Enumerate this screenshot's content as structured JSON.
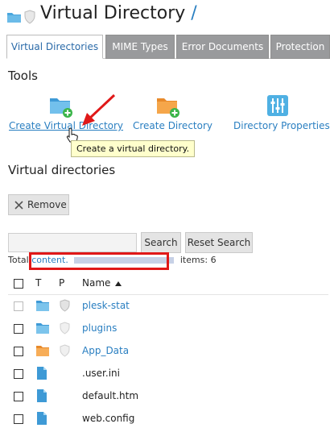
{
  "header": {
    "title": "Virtual Directory",
    "title_suffix": "/"
  },
  "tabs": [
    {
      "label": "Virtual Directories",
      "active": true
    },
    {
      "label": "MIME Types",
      "active": false
    },
    {
      "label": "Error Documents",
      "active": false
    },
    {
      "label": "Protection",
      "active": false
    }
  ],
  "tools": {
    "heading": "Tools",
    "items": [
      {
        "label": "Create Virtual Directory",
        "icon": "folder-add-blue-icon"
      },
      {
        "label": "Create Directory",
        "icon": "folder-add-orange-icon"
      },
      {
        "label": "Directory Properties",
        "icon": "sliders-icon"
      }
    ],
    "tooltip": "Create a virtual directory."
  },
  "list": {
    "heading": "Virtual directories",
    "remove_label": "Remove",
    "search_placeholder": "",
    "search_label": "Search",
    "reset_label": "Reset Search",
    "total_prefix": "Total",
    "total_link": "content.",
    "total_suffix": "items: 6",
    "columns": {
      "type": "T",
      "protection": "P",
      "name": "Name"
    },
    "rows": [
      {
        "name": "plesk-stat",
        "kind": "folder-blue",
        "link": true
      },
      {
        "name": "plugins",
        "kind": "folder-blue",
        "link": true
      },
      {
        "name": "App_Data",
        "kind": "folder-orange",
        "link": true
      },
      {
        "name": ".user.ini",
        "kind": "file",
        "link": false
      },
      {
        "name": "default.htm",
        "kind": "file",
        "link": false
      },
      {
        "name": "web.config",
        "kind": "file",
        "link": false
      }
    ]
  },
  "colors": {
    "accent": "#2a7fc1",
    "tab_inactive": "#999a9c",
    "highlight": "#e01818",
    "tooltip_bg": "#ffffcc"
  }
}
